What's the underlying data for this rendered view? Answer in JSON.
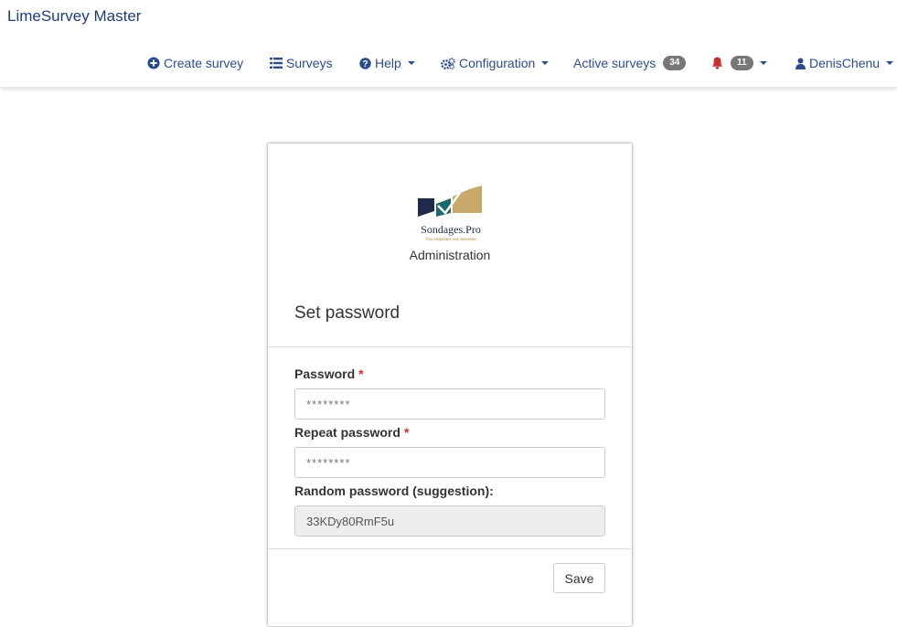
{
  "app": {
    "brand": "LimeSurvey Master"
  },
  "nav": {
    "create_survey": "Create survey",
    "surveys": "Surveys",
    "help": "Help",
    "configuration": "Configuration",
    "active_surveys": "Active surveys",
    "active_surveys_count": "34",
    "notifications_count": "11",
    "user": "DenisChenu"
  },
  "card": {
    "logo_text": "Sondages.Pro",
    "logo_tagline": "Vos enquêtes sur internet",
    "admin_label": "Administration",
    "title": "Set password",
    "password_label": "Password",
    "password_placeholder": "********",
    "repeat_label": "Repeat password",
    "repeat_placeholder": "********",
    "random_label": "Random password (suggestion):",
    "random_value": "33KDy80RmF5u",
    "required_marker": "*",
    "save_label": "Save"
  },
  "colors": {
    "link": "#2b4c8c",
    "required": "#c9302c",
    "badge": "#777777",
    "logo_navy": "#1d2a4a",
    "logo_teal": "#1b6a6b",
    "logo_gold": "#c8a96a"
  }
}
